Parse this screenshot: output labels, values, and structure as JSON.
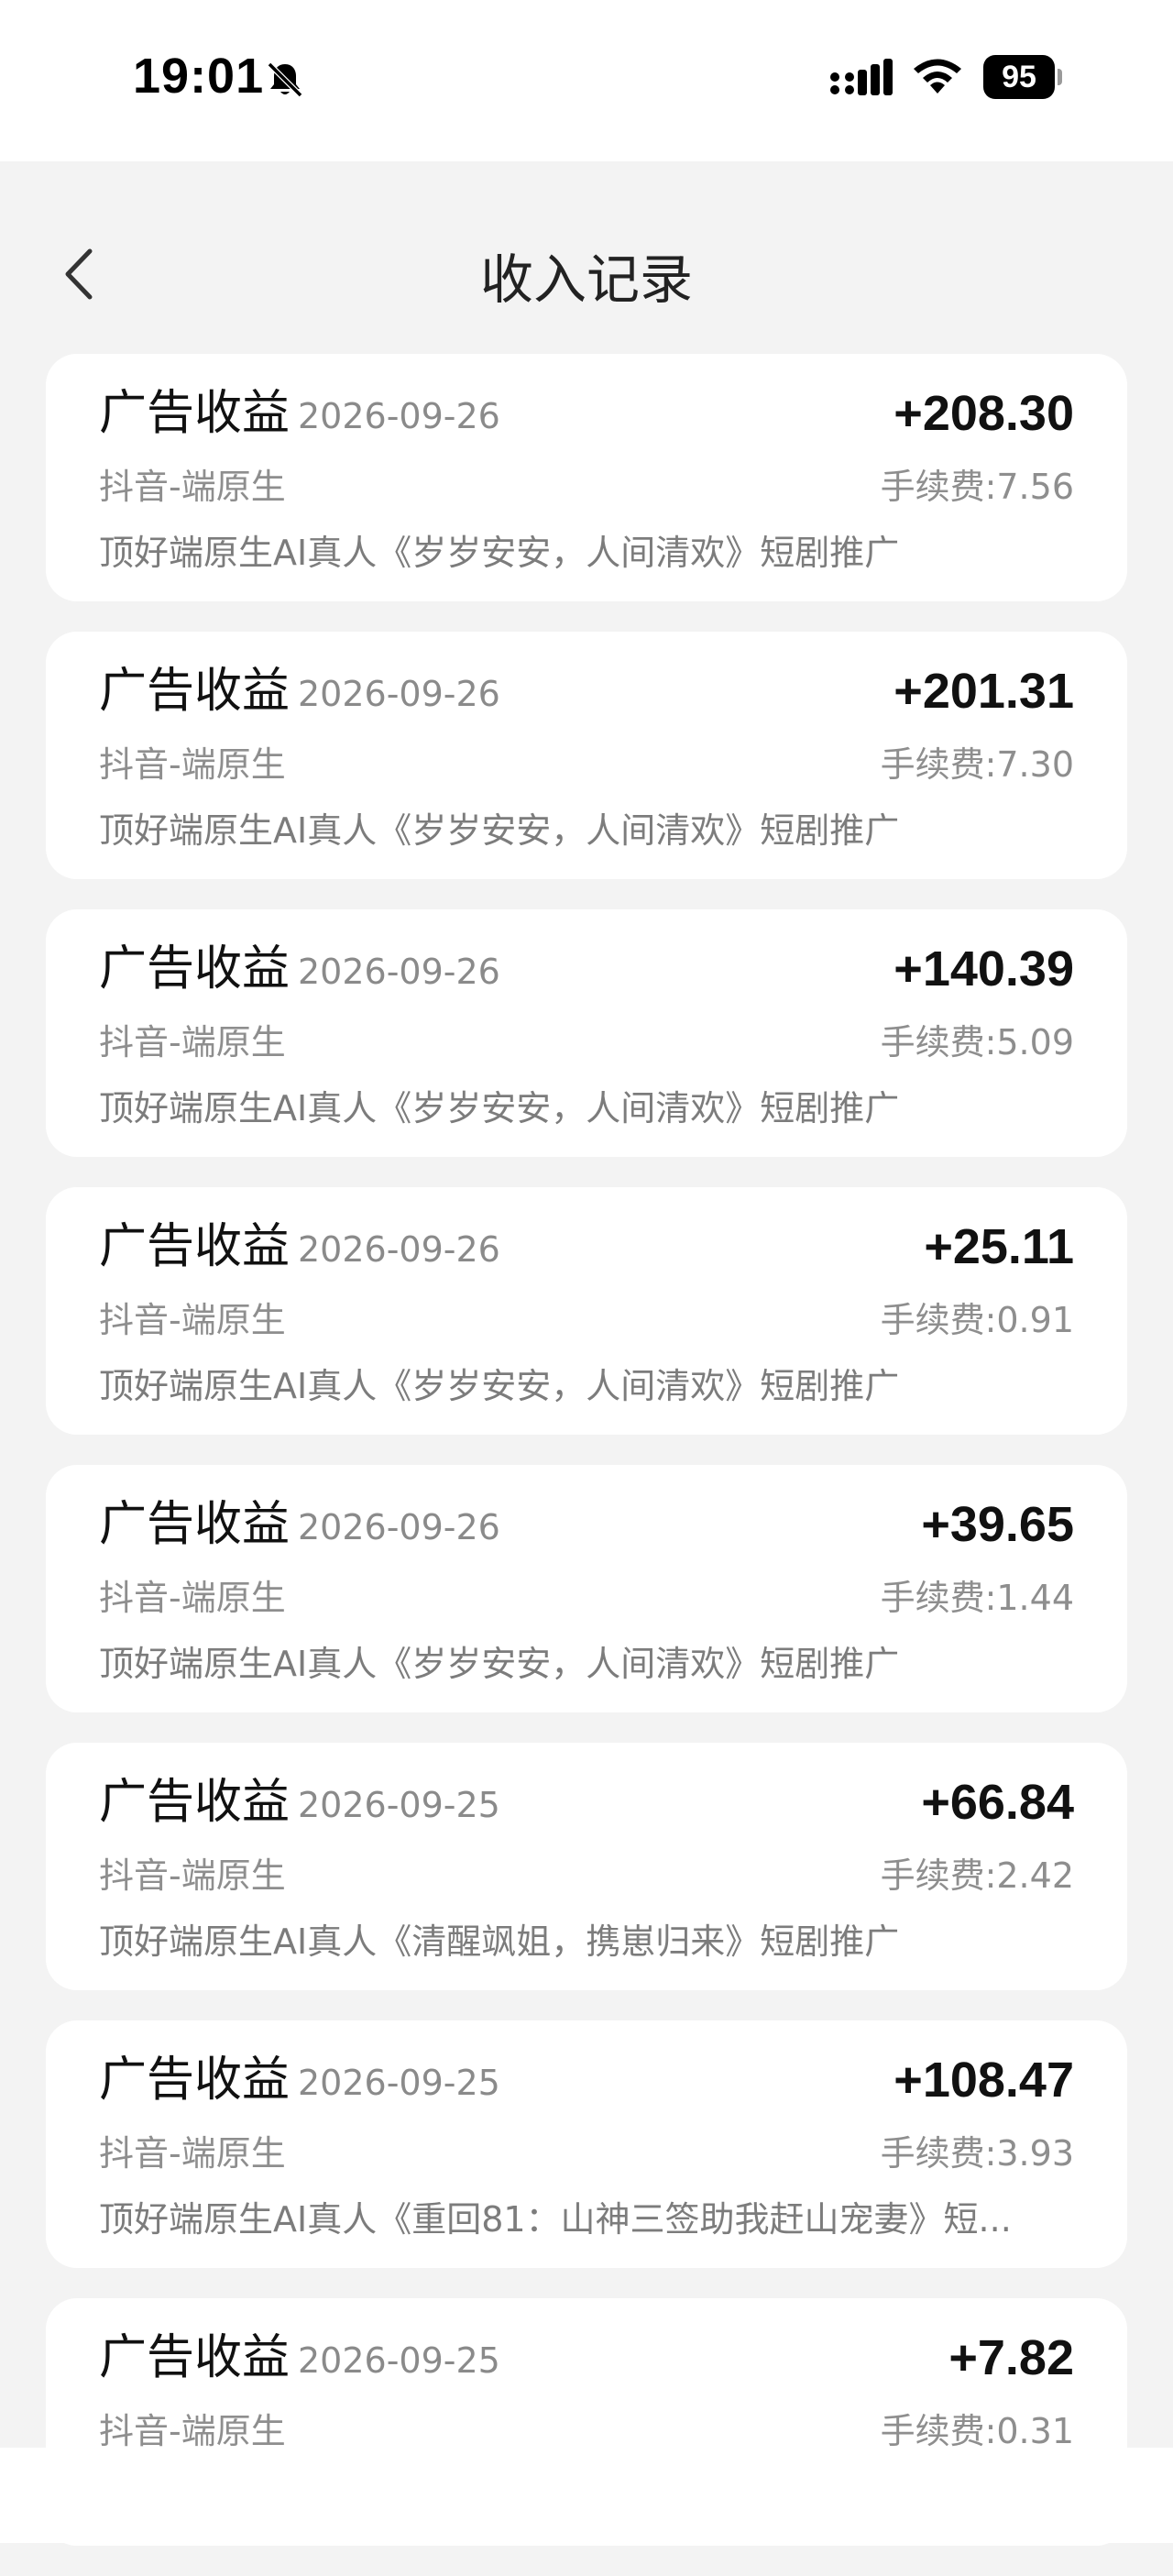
{
  "status_bar": {
    "time": "19:01",
    "battery": "95",
    "icons": [
      "bell-muted-icon",
      "cellular-signal-icon",
      "wifi-icon",
      "battery-icon"
    ]
  },
  "header": {
    "title": "收入记录",
    "back_icon": "chevron-left-icon"
  },
  "records": [
    {
      "title": "广告收益",
      "date": "2026-09-26",
      "amount": "+208.30",
      "source": "抖音-端原生",
      "fee": "手续费:7.56",
      "description": "顶好端原生AI真人《岁岁安安，人间清欢》短剧推广"
    },
    {
      "title": "广告收益",
      "date": "2026-09-26",
      "amount": "+201.31",
      "source": "抖音-端原生",
      "fee": "手续费:7.30",
      "description": "顶好端原生AI真人《岁岁安安，人间清欢》短剧推广"
    },
    {
      "title": "广告收益",
      "date": "2026-09-26",
      "amount": "+140.39",
      "source": "抖音-端原生",
      "fee": "手续费:5.09",
      "description": "顶好端原生AI真人《岁岁安安，人间清欢》短剧推广"
    },
    {
      "title": "广告收益",
      "date": "2026-09-26",
      "amount": "+25.11",
      "source": "抖音-端原生",
      "fee": "手续费:0.91",
      "description": "顶好端原生AI真人《岁岁安安，人间清欢》短剧推广"
    },
    {
      "title": "广告收益",
      "date": "2026-09-26",
      "amount": "+39.65",
      "source": "抖音-端原生",
      "fee": "手续费:1.44",
      "description": "顶好端原生AI真人《岁岁安安，人间清欢》短剧推广"
    },
    {
      "title": "广告收益",
      "date": "2026-09-25",
      "amount": "+66.84",
      "source": "抖音-端原生",
      "fee": "手续费:2.42",
      "description": "顶好端原生AI真人《清醒飒姐，携崽归来》短剧推广"
    },
    {
      "title": "广告收益",
      "date": "2026-09-25",
      "amount": "+108.47",
      "source": "抖音-端原生",
      "fee": "手续费:3.93",
      "description": "顶好端原生AI真人《重回81：山神三签助我赶山宠妻》短..."
    },
    {
      "title": "广告收益",
      "date": "2026-09-25",
      "amount": "+7.82",
      "source": "抖音-端原生",
      "fee": "手续费:0.31",
      "description": ""
    }
  ]
}
